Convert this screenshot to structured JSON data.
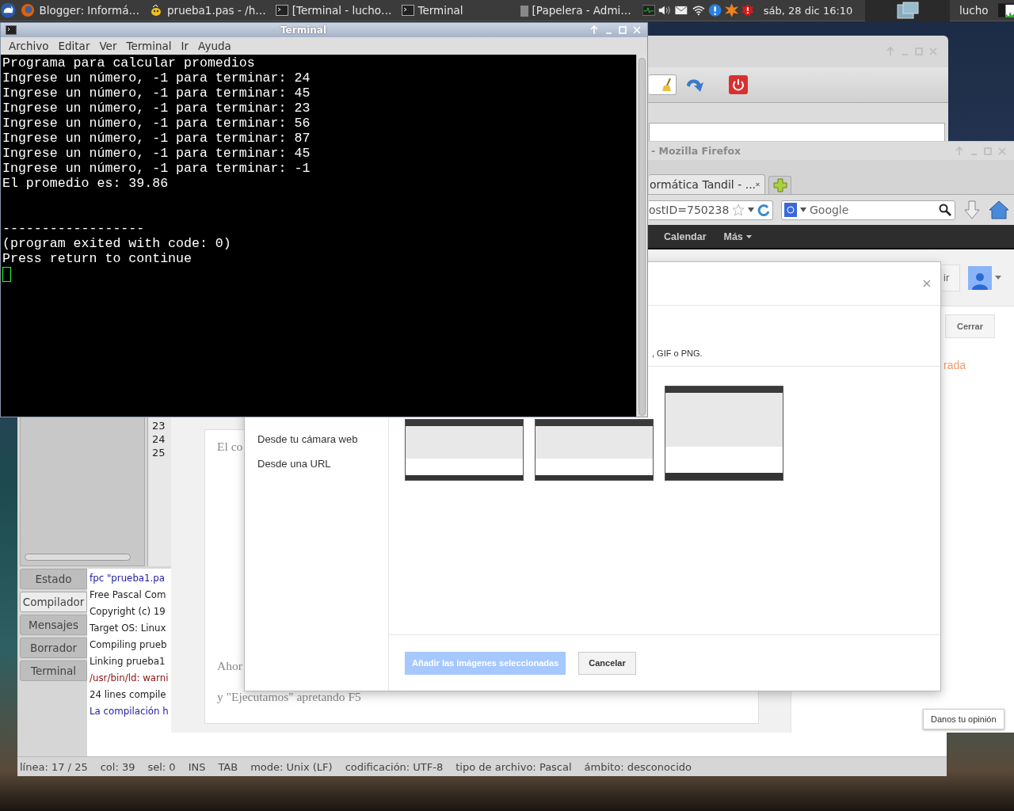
{
  "taskbar": {
    "tasks": [
      {
        "label": "Blogger: Informá…",
        "kind": "browser"
      },
      {
        "label": "prueba1.pas - /h…",
        "kind": "editor"
      },
      {
        "label": "[Terminal - lucho…",
        "kind": "terminal"
      },
      {
        "label": "Terminal",
        "kind": "terminal"
      },
      {
        "label": "[Papelera - Admi…",
        "kind": "trash"
      }
    ],
    "clock": "sáb, 28 dic  16:10",
    "user": "lucho"
  },
  "terminal": {
    "title": "Terminal",
    "menu": [
      "Archivo",
      "Editar",
      "Ver",
      "Terminal",
      "Ir",
      "Ayuda"
    ],
    "lines": [
      {
        "text": "Programa para calcular promedios",
        "kind": "output"
      },
      {
        "text": "Ingrese un número, -1 para terminar: 24",
        "kind": "output"
      },
      {
        "text": "Ingrese un número, -1 para terminar: 45",
        "kind": "output"
      },
      {
        "text": "Ingrese un número, -1 para terminar: 23",
        "kind": "output"
      },
      {
        "text": "Ingrese un número, -1 para terminar: 56",
        "kind": "output"
      },
      {
        "text": "Ingrese un número, -1 para terminar: 87",
        "kind": "output"
      },
      {
        "text": "Ingrese un número, -1 para terminar: 45",
        "kind": "output"
      },
      {
        "text": "Ingrese un número, -1 para terminar: -1",
        "kind": "output"
      },
      {
        "text": "El promedio es: 39.86",
        "kind": "output"
      },
      {
        "text": "------------------",
        "kind": "separator"
      },
      {
        "text": "(program exited with code: 0)",
        "kind": "output"
      },
      {
        "text": "Press return to continue",
        "kind": "output"
      }
    ]
  },
  "firefox": {
    "title": "- Mozilla Firefox",
    "tab": "ormática Tandil - ...",
    "url": "ostID=750238",
    "search_placeholder": "Google",
    "nav": [
      "Calendar",
      "Más"
    ],
    "share_button": "ir",
    "close_button": "Cerrar",
    "sidebar_text": "rada",
    "post_lines": [
      "El co",
      "Ahor",
      "y \"Ejecutamos\" apretando F5"
    ],
    "dialog": {
      "hint": ", GIF o PNG.",
      "sources": [
        "Desde tu cámara web",
        "Desde una URL"
      ],
      "add_button": {
        "label": "Añadir las imágenes seleccionadas",
        "disabled": true
      },
      "cancel_button": "Cancelar"
    },
    "feedback_button": "Danos tu opinión"
  },
  "editor": {
    "line_numbers": [
      "23",
      "24",
      "25"
    ],
    "message_tabs": [
      {
        "label": "Estado",
        "selected": false
      },
      {
        "label": "Compilador",
        "selected": true
      },
      {
        "label": "Mensajes",
        "selected": false
      },
      {
        "label": "Borrador",
        "selected": false
      },
      {
        "label": "Terminal",
        "selected": false
      }
    ],
    "messages": [
      {
        "text": "fpc \"prueba1.pa",
        "kind": "command"
      },
      {
        "text": "Free Pascal Com",
        "kind": "normal"
      },
      {
        "text": "Copyright (c) 19",
        "kind": "normal"
      },
      {
        "text": "Target OS: Linux",
        "kind": "normal"
      },
      {
        "text": "Compiling prueb",
        "kind": "normal"
      },
      {
        "text": "Linking prueba1",
        "kind": "normal"
      },
      {
        "text": "/usr/bin/ld: warni",
        "kind": "error"
      },
      {
        "text": "24 lines compile",
        "kind": "normal"
      },
      {
        "text": "La compilación h",
        "kind": "command"
      }
    ],
    "status_bar": [
      "línea: 17 / 25",
      "col: 39",
      "sel: 0",
      "INS",
      "TAB",
      "mode: Unix (LF)",
      "codificación: UTF-8",
      "tipo de archivo: Pascal",
      "ámbito: desconocido"
    ]
  }
}
